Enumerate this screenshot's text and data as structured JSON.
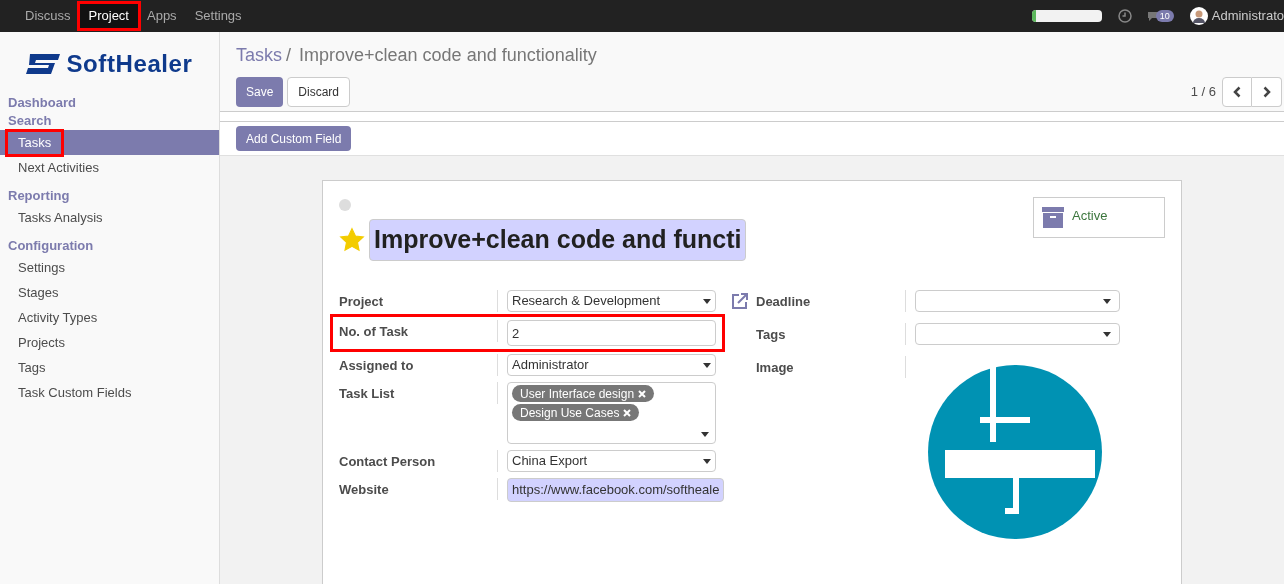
{
  "top_menu": [
    {
      "label": "Discuss",
      "highlighted": false
    },
    {
      "label": "Project",
      "highlighted": true
    },
    {
      "label": "Apps",
      "highlighted": false
    },
    {
      "label": "Settings",
      "highlighted": false
    }
  ],
  "systray": {
    "progress": {
      "level": 0.06
    },
    "messages_count": "10",
    "user": "Administrato"
  },
  "sidebar": {
    "logo": "SoftHealer",
    "sections": [
      {
        "title": "Dashboard"
      },
      {
        "title": "Search",
        "items": [
          {
            "label": "Tasks",
            "selected": true,
            "highlighted": true
          },
          {
            "label": "Next Activities",
            "selected": false,
            "highlighted": false
          }
        ]
      },
      {
        "title": "Reporting",
        "items": [
          {
            "label": "Tasks Analysis",
            "selected": false,
            "highlighted": false
          }
        ]
      },
      {
        "title": "Configuration",
        "items": [
          {
            "label": "Settings",
            "selected": false,
            "highlighted": false
          },
          {
            "label": "Stages",
            "selected": false,
            "highlighted": false
          },
          {
            "label": "Activity Types",
            "selected": false,
            "highlighted": false
          },
          {
            "label": "Projects",
            "selected": false,
            "highlighted": false
          },
          {
            "label": "Tags",
            "selected": false,
            "highlighted": false
          },
          {
            "label": "Task Custom Fields",
            "selected": false,
            "highlighted": false
          }
        ]
      }
    ]
  },
  "breadcrumb": {
    "parent": "Tasks",
    "separator": "/",
    "current": "Improve+clean code and functionality"
  },
  "buttons": {
    "save": "Save",
    "discard": "Discard",
    "add_custom_field": "Add Custom Field"
  },
  "pager": "1 / 6",
  "form": {
    "starred": true,
    "title": "Improve+clean code and functi",
    "active_button": "Active",
    "left_fields": [
      {
        "label": "Project",
        "kind": "select",
        "value": "Research & Development",
        "highlighted": false
      },
      {
        "label": "No. of Task",
        "kind": "input",
        "value": "2",
        "highlighted": true
      },
      {
        "label": "Assigned to",
        "kind": "select",
        "value": "Administrator",
        "highlighted": false
      },
      {
        "label": "Task List",
        "kind": "tags",
        "tags": [
          "User Interface design",
          "Design Use Cases"
        ],
        "highlighted": false
      },
      {
        "label": "Contact Person",
        "kind": "select",
        "value": "China Export",
        "highlighted": false
      },
      {
        "label": "Website",
        "kind": "url",
        "value": "https://www.facebook.com/softheale",
        "highlighted": false
      }
    ],
    "right_fields": [
      {
        "label": "Deadline",
        "kind": "select"
      },
      {
        "label": "Tags",
        "kind": "select"
      },
      {
        "label": "Image"
      }
    ]
  }
}
